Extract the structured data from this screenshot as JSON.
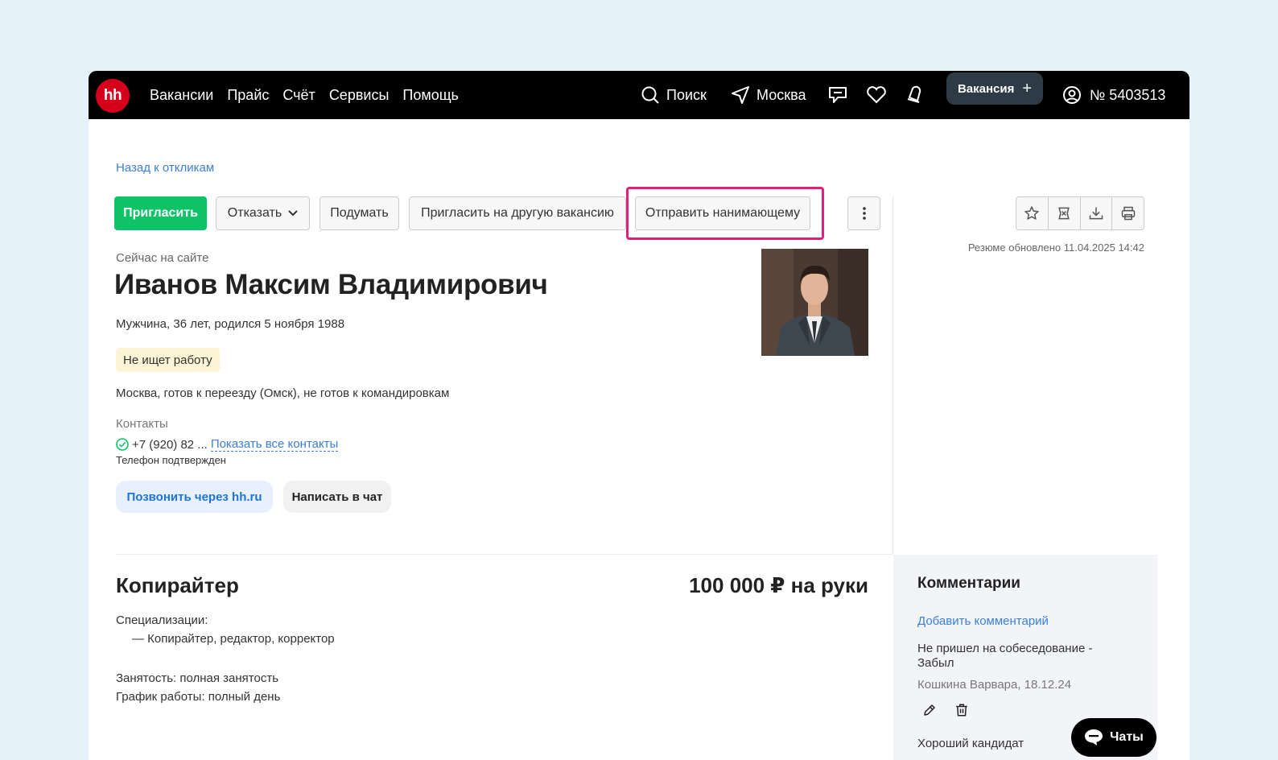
{
  "header": {
    "logo": "hh",
    "nav": [
      "Вакансии",
      "Прайс",
      "Счёт",
      "Сервисы",
      "Помощь"
    ],
    "search_label": "Поиск",
    "city_label": "Москва",
    "vacancy_button": "Вакансия",
    "account_label": "№ 5403513"
  },
  "back_link": "Назад к откликам",
  "actions": {
    "invite": "Пригласить",
    "reject": "Отказать",
    "think": "Подумать",
    "invite_other": "Пригласить на другую вакансию",
    "send_to_hiring": "Отправить нанимающему"
  },
  "resume_updated": "Резюме обновлено 11.04.2025 14:42",
  "candidate": {
    "online_status": "Сейчас на сайте",
    "name": "Иванов Максим Владимирович",
    "bio": "Мужчина, 36 лет, родился 5 ноября 1988",
    "job_status": "Не ищет работу",
    "relocation": "Москва, готов к переезду (Омск), не готов к командировкам",
    "contacts_label": "Контакты",
    "phone": "+7 (920) 82 ...",
    "show_contacts": "Показать все контакты",
    "phone_verified": "Телефон подтвержден",
    "call_button": "Позвонить через hh.ru",
    "chat_button": "Написать в чат"
  },
  "position": {
    "title": "Копирайтер",
    "salary": "100 000 ₽ на руки",
    "specializations_label": "Специализации:",
    "specialization_item": "— Копирайтер, редактор, корректор",
    "employment": "Занятость: полная занятость",
    "schedule": "График работы: полный день"
  },
  "comments": {
    "title": "Комментарии",
    "add": "Добавить комментарий",
    "items": [
      {
        "text": "Не пришел на собеседование - Забыл",
        "author": "Кошкина Варвара, 18.12.24"
      },
      {
        "text": "Хороший кандидат"
      }
    ]
  },
  "chats_button": "Чаты",
  "colors": {
    "accent_green": "#0dc267",
    "link_blue": "#3b7fd6",
    "highlight": "#e0207d",
    "logo_red": "#d6001c"
  }
}
